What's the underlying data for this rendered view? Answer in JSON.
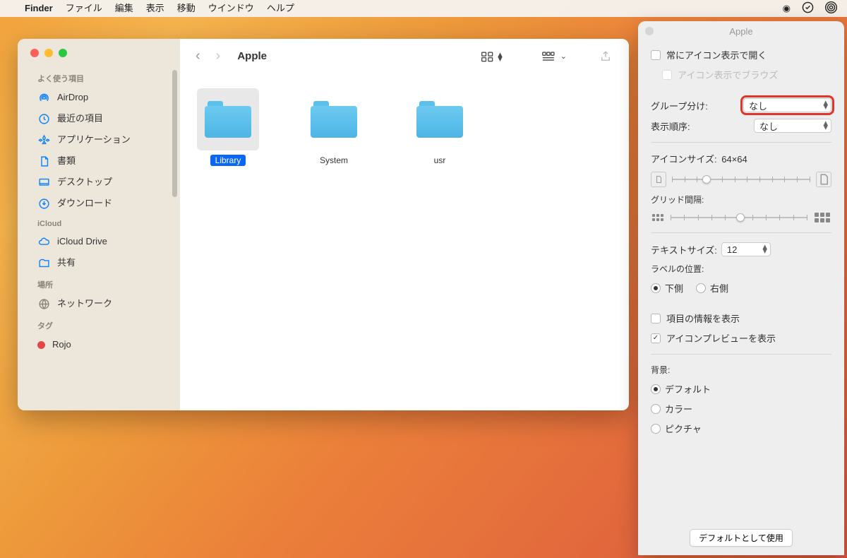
{
  "menubar": {
    "app": "Finder",
    "items": [
      "ファイル",
      "編集",
      "表示",
      "移動",
      "ウインドウ",
      "ヘルプ"
    ]
  },
  "sidebar": {
    "sec1": {
      "title": "よく使う項目",
      "items": [
        "AirDrop",
        "最近の項目",
        "アプリケーション",
        "書類",
        "デスクトップ",
        "ダウンロード"
      ]
    },
    "sec2": {
      "title": "iCloud",
      "items": [
        "iCloud Drive",
        "共有"
      ]
    },
    "sec3": {
      "title": "場所",
      "items": [
        "ネットワーク"
      ]
    },
    "sec4": {
      "title": "タグ",
      "items": [
        "Rojo"
      ]
    }
  },
  "toolbar": {
    "title": "Apple"
  },
  "folders": [
    {
      "name": "Library",
      "selected": true
    },
    {
      "name": "System",
      "selected": false
    },
    {
      "name": "usr",
      "selected": false
    }
  ],
  "opts": {
    "title": "Apple",
    "always_icon": "常にアイコン表示で開く",
    "browse_icon": "アイコン表示でブラウズ",
    "group_label": "グループ分け:",
    "group_value": "なし",
    "order_label": "表示順序:",
    "order_value": "なし",
    "iconsize_label": "アイコンサイズ:",
    "iconsize_value": "64×64",
    "grid_label": "グリッド間隔:",
    "textsize_label": "テキストサイズ:",
    "textsize_value": "12",
    "labelpos_label": "ラベルの位置:",
    "labelpos_bottom": "下側",
    "labelpos_right": "右側",
    "showinfo": "項目の情報を表示",
    "showpreview": "アイコンプレビューを表示",
    "bg_label": "背景:",
    "bg_default": "デフォルト",
    "bg_color": "カラー",
    "bg_picture": "ピクチャ",
    "defaults_btn": "デフォルトとして使用"
  }
}
